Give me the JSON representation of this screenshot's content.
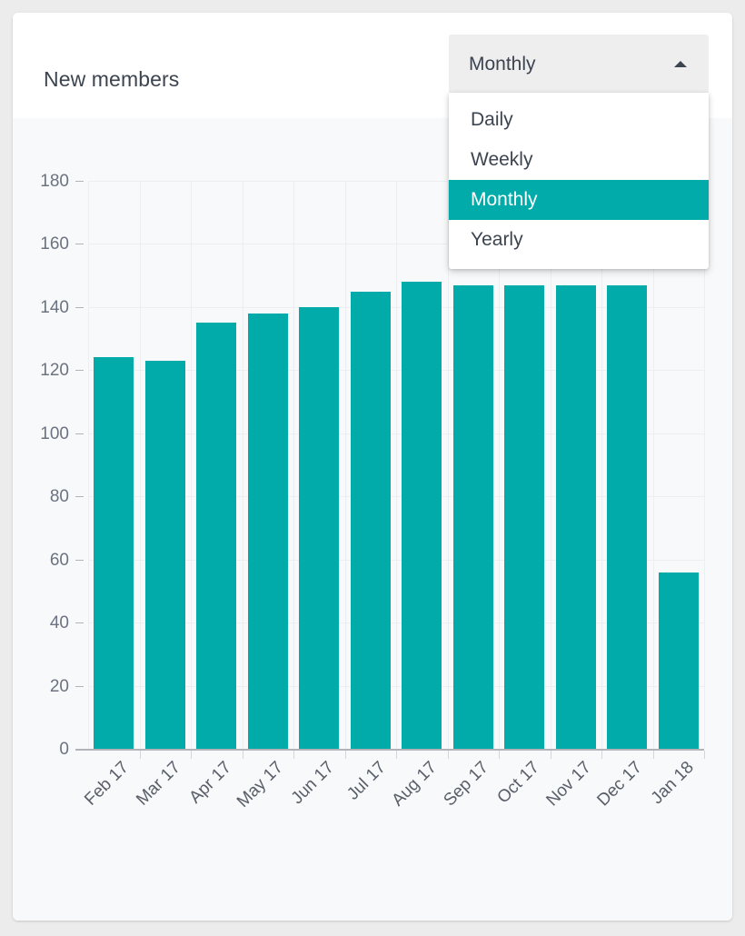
{
  "card": {
    "title": "New members"
  },
  "range_select": {
    "name": "range-select",
    "selected": "Monthly",
    "expanded": true,
    "caret_icon": "chevron-up-icon",
    "options": [
      "Daily",
      "Weekly",
      "Monthly",
      "Yearly"
    ]
  },
  "colors": {
    "bar": "#00aba9",
    "accent": "#00aba9",
    "page_background": "#ececec",
    "card_background": "#ffffff",
    "chart_background": "#f8f9fa",
    "select_background": "#eeeeee",
    "title_text": "#3c4450",
    "axis_text": "#6b7280",
    "gridline": "#eceef0"
  },
  "chart_data": {
    "type": "bar",
    "title": "New members",
    "xlabel": "",
    "ylabel": "",
    "ylim": [
      0,
      180
    ],
    "yticks": [
      0,
      20,
      40,
      60,
      80,
      100,
      120,
      140,
      160,
      180
    ],
    "grid": true,
    "legend": false,
    "categories": [
      "Feb 17",
      "Mar 17",
      "Apr 17",
      "May 17",
      "Jun 17",
      "Jul 17",
      "Aug 17",
      "Sep 17",
      "Oct 17",
      "Nov 17",
      "Dec 17",
      "Jan 18"
    ],
    "values": [
      124,
      123,
      135,
      138,
      140,
      145,
      148,
      147,
      147,
      147,
      147,
      56
    ],
    "series": [
      {
        "name": "New members",
        "color": "#00aba9",
        "values": [
          124,
          123,
          135,
          138,
          140,
          145,
          148,
          147,
          147,
          147,
          147,
          56
        ]
      }
    ]
  }
}
